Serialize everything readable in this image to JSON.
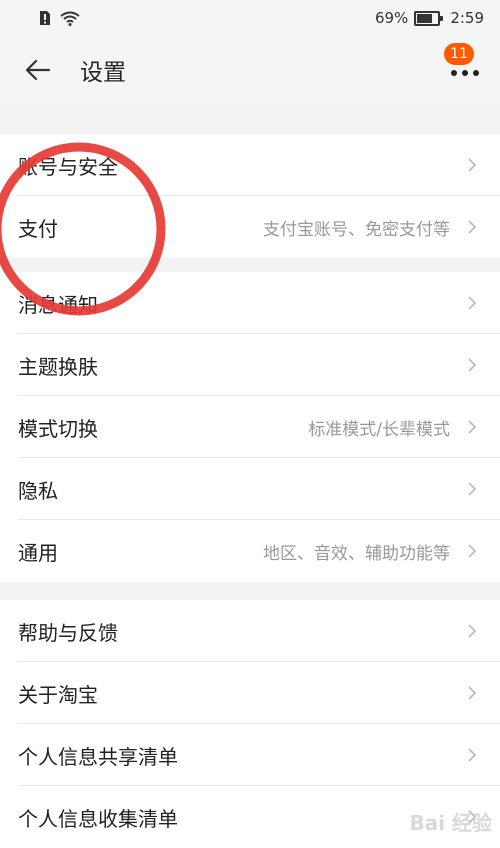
{
  "status_bar": {
    "battery": "69%",
    "time": "2:59"
  },
  "header": {
    "title": "设置",
    "badge": "11"
  },
  "groups": [
    {
      "items": [
        {
          "label": "账号与安全",
          "value": ""
        },
        {
          "label": "支付",
          "value": "支付宝账号、免密支付等"
        }
      ]
    },
    {
      "items": [
        {
          "label": "消息通知",
          "value": ""
        },
        {
          "label": "主题换肤",
          "value": ""
        },
        {
          "label": "模式切换",
          "value": "标准模式/长辈模式"
        },
        {
          "label": "隐私",
          "value": ""
        },
        {
          "label": "通用",
          "value": "地区、音效、辅助功能等"
        }
      ]
    },
    {
      "items": [
        {
          "label": "帮助与反馈",
          "value": ""
        },
        {
          "label": "关于淘宝",
          "value": ""
        },
        {
          "label": "个人信息共享清单",
          "value": ""
        },
        {
          "label": "个人信息收集清单",
          "value": ""
        }
      ]
    }
  ],
  "watermark": "Bai 经验",
  "colors": {
    "accent": "#ff5a00",
    "annotation": "#e53935"
  }
}
